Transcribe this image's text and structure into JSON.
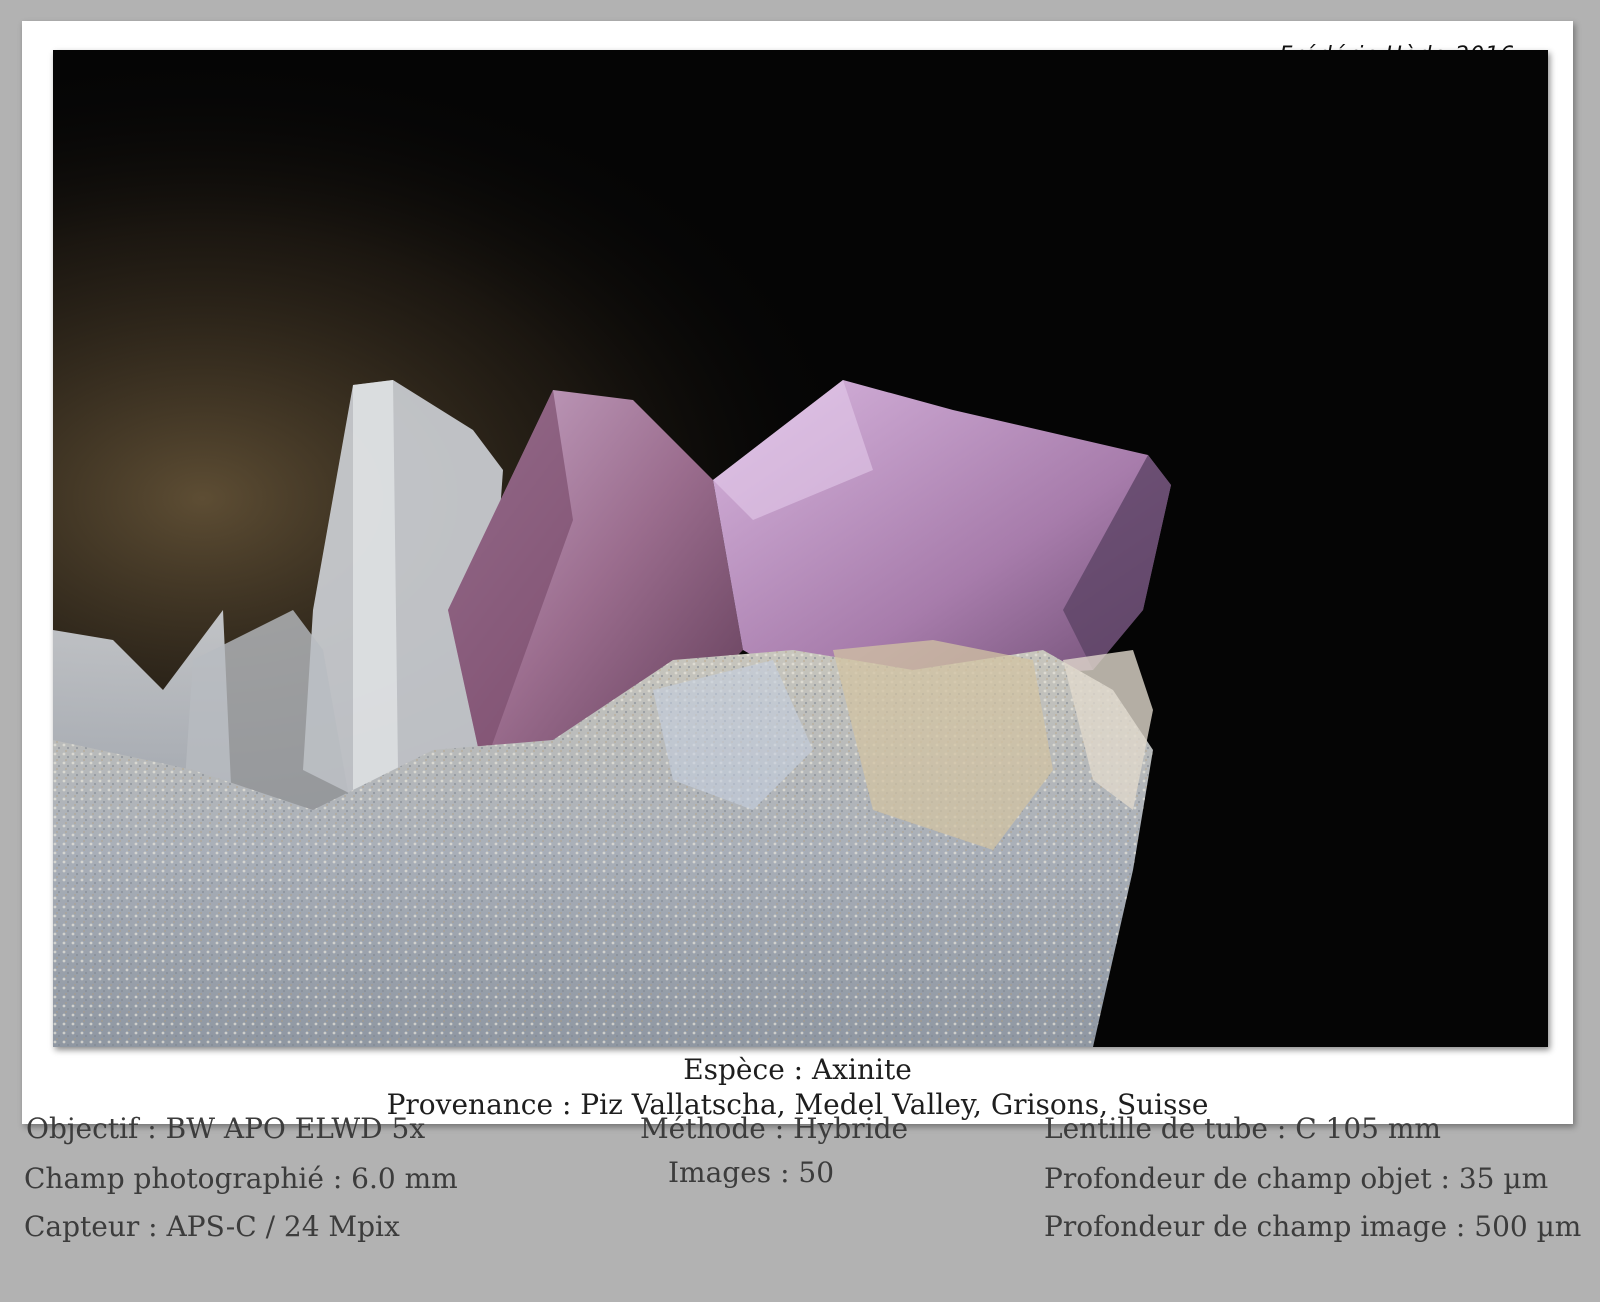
{
  "signature": "Frédéric Hède 2016",
  "caption": {
    "species": "Espèce : Axinite",
    "provenance": "Provenance : Piz Vallatscha, Medel Valley, Grisons, Suisse"
  },
  "specs": {
    "objective": "Objectif : BW APO ELWD 5x",
    "field": "Champ photographié : 6.0 mm",
    "sensor": "Capteur : APS-C / 24 Mpix",
    "method": "Méthode : Hybride",
    "images": "Images : 50",
    "tube_lens": "Lentille de tube : C 105 mm",
    "dof_object": "Profondeur de champ objet : 35 µm",
    "dof_image": "Profondeur de champ image : 500 µm"
  }
}
